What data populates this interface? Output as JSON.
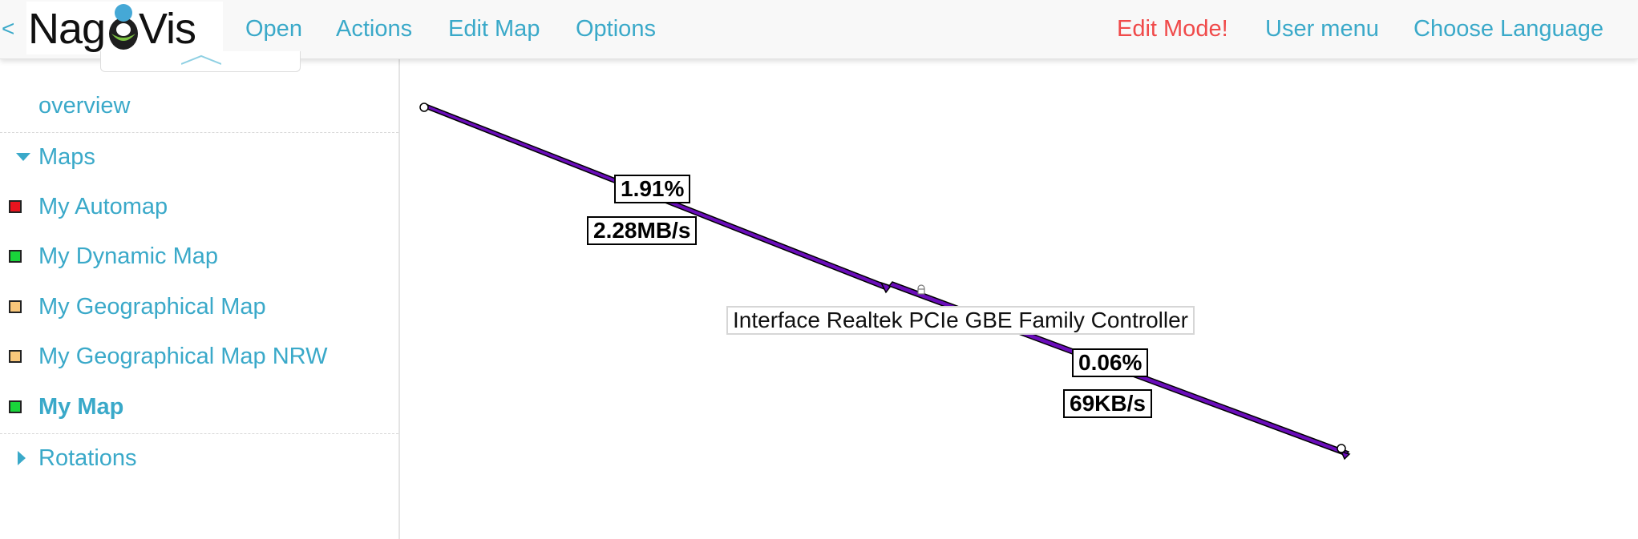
{
  "header": {
    "back_glyph": "<",
    "logo_left": "Nag",
    "logo_right": "Vis",
    "menu": {
      "open": "Open",
      "actions": "Actions",
      "edit_map": "Edit Map",
      "options": "Options",
      "edit_mode": "Edit Mode!",
      "user_menu": "User menu",
      "choose_language": "Choose Language"
    },
    "colors": {
      "link": "#3aa9c9",
      "edit_mode": "#f04a4a"
    }
  },
  "sidebar": {
    "overview": "overview",
    "maps_header": "Maps",
    "maps": [
      {
        "label": "My Automap",
        "state_color": "#e8141e"
      },
      {
        "label": "My Dynamic Map",
        "state_color": "#19d43a"
      },
      {
        "label": "My Geographical Map",
        "state_color": "#f9c77a"
      },
      {
        "label": "My Geographical Map NRW",
        "state_color": "#f9c77a"
      },
      {
        "label": "My Map",
        "state_color": "#19d43a",
        "active": true
      }
    ],
    "rotations_header": "Rotations"
  },
  "map": {
    "line_color": "#6a0dba",
    "labels": {
      "in_percent": "1.91%",
      "in_rate": "2.28MB/s",
      "out_percent": "0.06%",
      "out_rate": "69KB/s",
      "hover": "Interface Realtek PCIe GBE Family Controller"
    }
  }
}
